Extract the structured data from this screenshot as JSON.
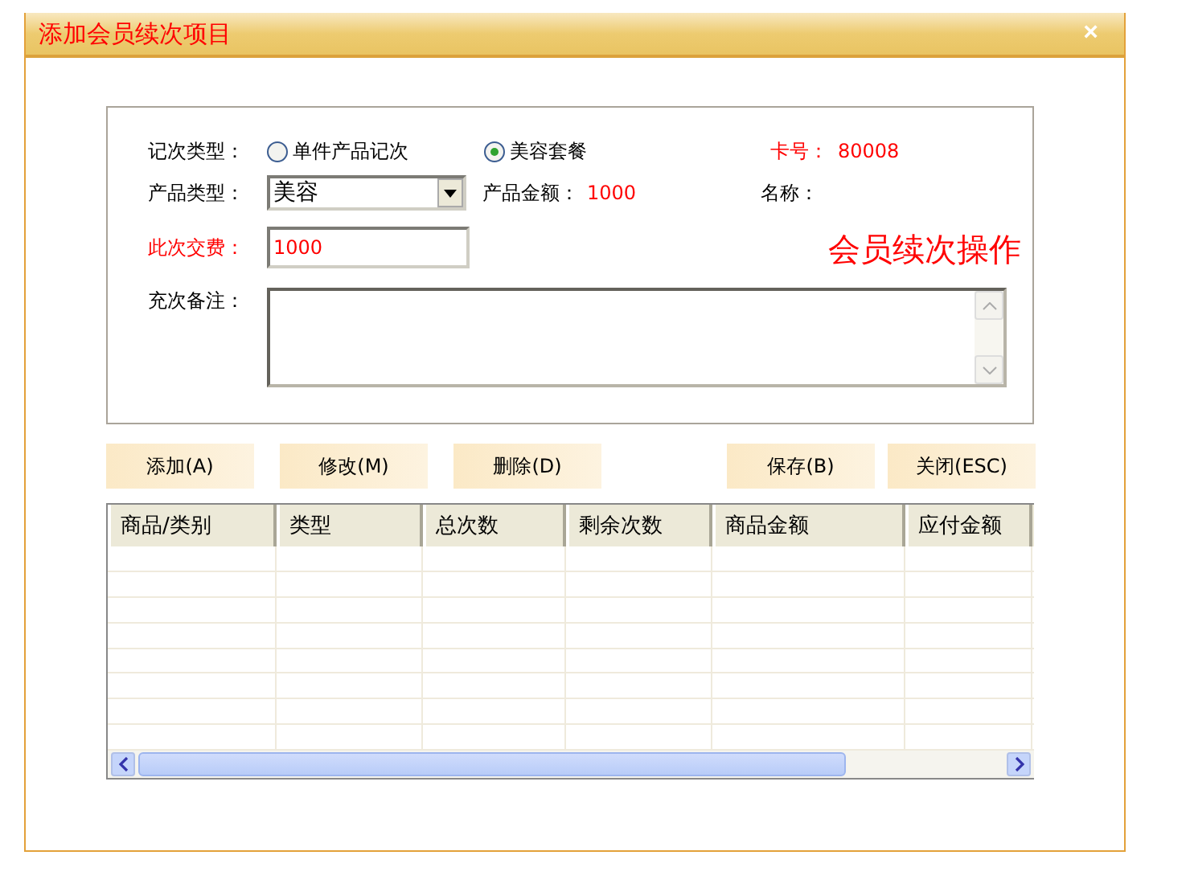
{
  "window": {
    "title": "添加会员续次项目",
    "close": "×"
  },
  "form": {
    "record_type_label": "记次类型：",
    "record_types": [
      {
        "label": "单件产品记次",
        "selected": false
      },
      {
        "label": "美容套餐",
        "selected": true
      }
    ],
    "card_label": "卡号：",
    "card_value": "80008",
    "product_type_label": "产品类型：",
    "product_type_value": "美容",
    "amount_label": "产品金额：",
    "amount_value": "1000",
    "name_label": "名称：",
    "fee_label": "此次交费：",
    "fee_value": "1000",
    "note_label": "充次备注：",
    "annotation": "会员续次操作"
  },
  "edit_buttons": [
    "添加(A)",
    "修改(M)",
    "删除(D)"
  ],
  "dialog_buttons": [
    "保存(B)",
    "关闭(ESC)"
  ],
  "table": {
    "columns": [
      "商品/类别",
      "类型",
      "总次数",
      "剩余次数",
      "商品金额",
      "应付金额"
    ]
  }
}
